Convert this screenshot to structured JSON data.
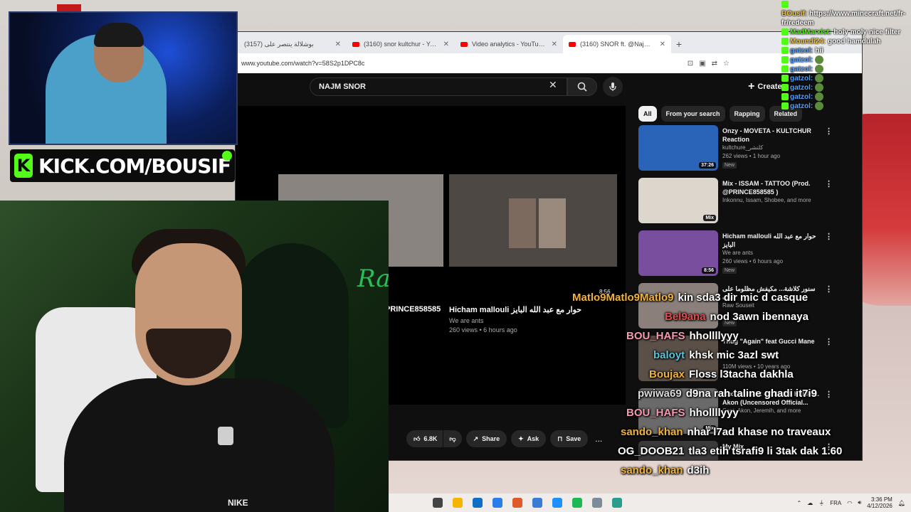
{
  "browser": {
    "tabs": [
      {
        "title": "(3157) بوشلالة ينتصر على",
        "active": false
      },
      {
        "title": "(3160) snor kultchur - YouTube",
        "active": false
      },
      {
        "title": "Video analytics - YouTube Studi",
        "active": false
      },
      {
        "title": "(3160) SNOR ft. @Najmtayer - ",
        "active": true
      }
    ],
    "url": "www.youtube.com/watch?v=58S2p1DPC8c"
  },
  "youtube": {
    "search_query": "NAJM SNOR",
    "create_label": "Create",
    "left_partial_label": "PRINCE858585",
    "video_title": "Hicham mallouli حوار مع عبد الله البايز",
    "video_channel": "We are ants",
    "video_stats": "260 views • 6 hours ago",
    "video_duration": "8:56",
    "actions": {
      "like_count": "6.8K",
      "share": "Share",
      "ask": "Ask",
      "save": "Save",
      "more": "..."
    },
    "chips": [
      "All",
      "From your search",
      "Rapping",
      "Related"
    ],
    "recommendations": [
      {
        "title": "Onzy - MOVETA - KULTCHUR Reaction",
        "channel": "kultchure_كلتشر",
        "views": "262 views • 1 hour ago",
        "badge": "New",
        "duration": "37:26",
        "thumb": "#2a64b8"
      },
      {
        "title": "Mix - ISSAM - TATTOO (Prod. @PRINCE858585 )",
        "channel": "Inkonnu, Issam, Shobee, and more",
        "views": "",
        "badge": "",
        "duration": "Mix",
        "thumb": "#dcd6cc"
      },
      {
        "title": "Hicham mallouli حوار مع عبد الله البايز",
        "channel": "We are ants",
        "views": "260 views • 6 hours ago",
        "badge": "New",
        "duration": "8:56",
        "thumb": "#7a4e9e"
      },
      {
        "title": "سنور كلاشة... مكيفش مظلوما على كلب",
        "channel": "Raw Souseit",
        "views": "",
        "badge": "New",
        "duration": "",
        "thumb": "#8a7f7a"
      },
      {
        "title": "Thug \"Again\" feat Gucci Mane",
        "channel": "",
        "views": "110M views • 10 years ago",
        "badge": "",
        "duration": "2:57",
        "thumb": "#5a5048"
      },
      {
        "title": "Mix - 50 Cent - Still Will Kill feat. Akon (Uncensored Official...",
        "channel": "Cent, Akon, Jeremih, and more",
        "views": "",
        "badge": "",
        "duration": "Mix",
        "thumb": "#6a6a6a"
      },
      {
        "title": "My Mix",
        "channel": "",
        "views": "",
        "badge": "",
        "duration": "",
        "thumb": "#3a3a3a"
      }
    ]
  },
  "stream": {
    "kick_text": "KICK.COM/BOUSIF",
    "kick_logo": "K",
    "neon_text": "Ra",
    "shirt_logo": "NIKE"
  },
  "chat_top": [
    {
      "nick": "BOusif:",
      "msg": "https://www.minecraft.net/fr-fr/redeem",
      "color": "#f5c542",
      "emote": false
    },
    {
      "nick": "MadMarxist:",
      "msg": "holy moly nice filter",
      "color": "#53fc18",
      "emote": false
    },
    {
      "nick": "Moundi24:",
      "msg": "good hamdulah",
      "color": "#f5c542",
      "emote": false
    },
    {
      "nick": "gatzol:",
      "msg": "hii",
      "color": "#53a0fc",
      "emote": false
    },
    {
      "nick": "gatzol:",
      "msg": "",
      "color": "#53a0fc",
      "emote": true
    },
    {
      "nick": "gatzol:",
      "msg": "",
      "color": "#53a0fc",
      "emote": true
    },
    {
      "nick": "gatzol:",
      "msg": "",
      "color": "#53a0fc",
      "emote": true
    },
    {
      "nick": "gatzol:",
      "msg": "",
      "color": "#53a0fc",
      "emote": true
    },
    {
      "nick": "gatzol:",
      "msg": "",
      "color": "#53a0fc",
      "emote": true
    },
    {
      "nick": "gatzol:",
      "msg": "",
      "color": "#53a0fc",
      "emote": true
    }
  ],
  "chat_big": [
    {
      "nick": "Matlo9Matlo9Matlo9",
      "msg": "kin sda3 dir mic d casque",
      "color": "#f0b23a"
    },
    {
      "nick": "Bel9ana",
      "msg": "nod 3awn ibennaya",
      "color": "#e04c4c"
    },
    {
      "nick": "BOU_HAFS",
      "msg": "hhollllyyy",
      "color": "#f59ab0"
    },
    {
      "nick": "baloyt",
      "msg": "khsk mic 3azl swt",
      "color": "#59c3d8"
    },
    {
      "nick": "Boujax",
      "msg": "Floss l3tacha dakhla",
      "color": "#f0b23a"
    },
    {
      "nick": "pwiwa69",
      "msg": "d9na rah taline ghadi it7i9",
      "color": "#dcdcdc"
    },
    {
      "nick": "BOU_HAFS",
      "msg": "hhollllyyy",
      "color": "#f59ab0"
    },
    {
      "nick": "sando_khan",
      "msg": "nhar l7ad khase no traveaux",
      "color": "#f0b23a"
    },
    {
      "nick": "OG_DOOB21",
      "msg": "tla3 etih tsrafi9 li 3tak dak 1.60",
      "color": "#ffffff"
    },
    {
      "nick": "sando_khan",
      "msg": "d3ih",
      "color": "#f0b23a"
    }
  ],
  "taskbar": {
    "lang": "FRA",
    "time": "3:36 PM",
    "date": "4/12/2026",
    "icons": [
      "#444444",
      "#f4b400",
      "#0f6fc6",
      "#2b7de9",
      "#e0592a",
      "#3a7bd5",
      "#1e90ff",
      "#1db954",
      "#7c8c9a",
      "#2a9d8f"
    ]
  }
}
